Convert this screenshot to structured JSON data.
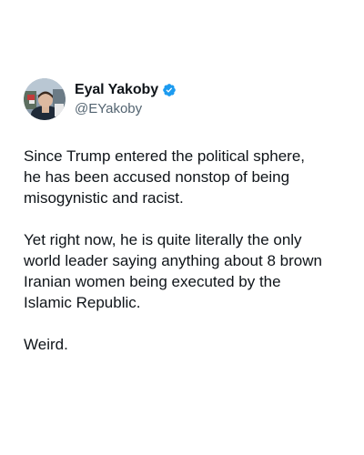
{
  "author": {
    "display_name": "Eyal Yakoby",
    "handle": "@EYakoby",
    "verified": true,
    "verified_color": "#1d9bf0"
  },
  "tweet": {
    "paragraphs": [
      "Since Trump entered the political sphere,\nhe has been accused nonstop of being\nmisogynistic  and racist.",
      "Yet right now, he is quite literally the only\nworld leader saying anything about 8 brown\nIranian women being executed by the\nIslamic Republic.",
      "Weird."
    ]
  }
}
